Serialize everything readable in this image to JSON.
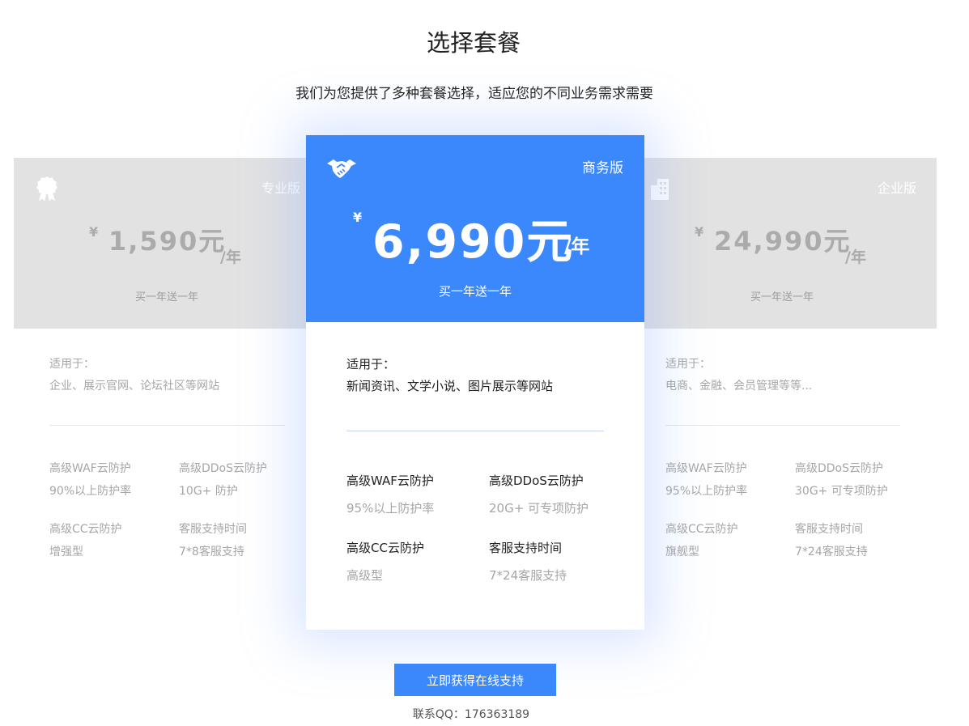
{
  "header": {
    "title": "选择套餐",
    "subtitle": "我们为您提供了多种套餐选择，适应您的不同业务需求需要"
  },
  "plans": [
    {
      "name": "专业版",
      "currency": "¥",
      "amount": "1,590元",
      "unit": "/年",
      "promo": "买一年送一年",
      "suitable_label": "适用于：",
      "suitable_for": "企业、展示官网、论坛社区等网站",
      "features": [
        {
          "title": "高级WAF云防护",
          "value": "90%以上防护率"
        },
        {
          "title": "高级DDoS云防护",
          "value": "10G+ 防护"
        },
        {
          "title": "高级CC云防护",
          "value": "增强型"
        },
        {
          "title": "客服支持时间",
          "value": "7*8客服支持"
        }
      ]
    },
    {
      "name": "商务版",
      "currency": "¥",
      "amount": "6,990元",
      "unit": "/年",
      "promo": "买一年送一年",
      "suitable_label": "适用于：",
      "suitable_for": "新闻资讯、文学小说、图片展示等网站",
      "features": [
        {
          "title": "高级WAF云防护",
          "value": "95%以上防护率"
        },
        {
          "title": "高级DDoS云防护",
          "value": "20G+ 可专项防护"
        },
        {
          "title": "高级CC云防护",
          "value": "高级型"
        },
        {
          "title": "客服支持时间",
          "value": "7*24客服支持"
        }
      ]
    },
    {
      "name": "企业版",
      "currency": "¥",
      "amount": "24,990元",
      "unit": "/年",
      "promo": "买一年送一年",
      "suitable_label": "适用于：",
      "suitable_for": "电商、金融、会员管理等等...",
      "features": [
        {
          "title": "高级WAF云防护",
          "value": "95%以上防护率"
        },
        {
          "title": "高级DDoS云防护",
          "value": "30G+ 可专项防护"
        },
        {
          "title": "高级CC云防护",
          "value": "旗舰型"
        },
        {
          "title": "客服支持时间",
          "value": "7*24客服支持"
        }
      ]
    }
  ],
  "icons": {
    "pro": "award-ribbon-icon",
    "business": "handshake-icon",
    "enterprise": "building-icon"
  },
  "colors": {
    "accent": "#3b88fd",
    "muted_card": "#e2e2e2"
  },
  "cta": {
    "button_label": "立即获得在线支持",
    "contact": "联系QQ：176363189"
  }
}
